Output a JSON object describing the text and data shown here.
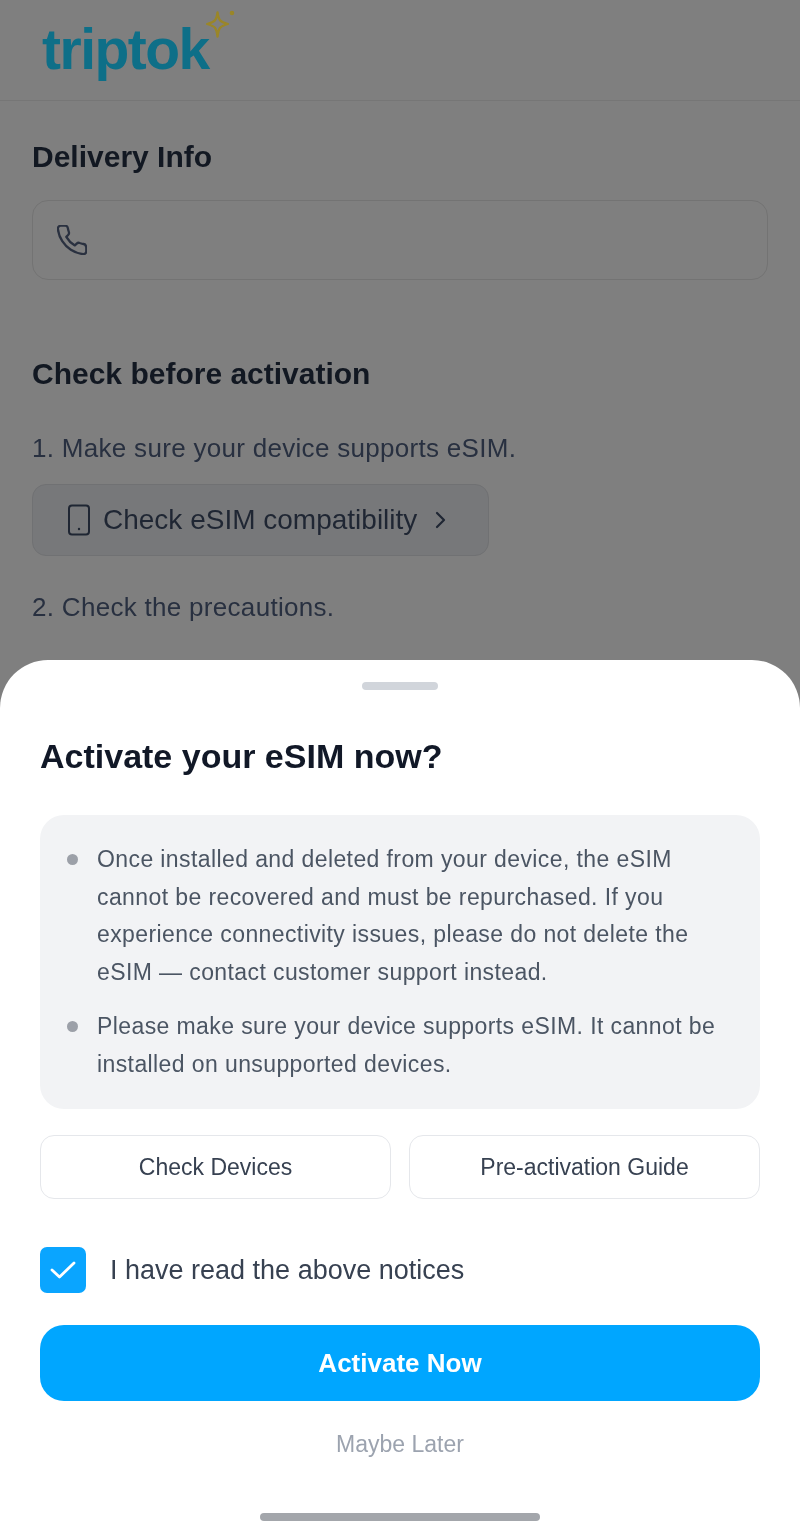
{
  "header": {
    "logo": "triptok"
  },
  "delivery_info": {
    "title": "Delivery Info"
  },
  "check_section": {
    "title": "Check before activation",
    "steps": [
      {
        "text": "1. Make sure your device supports eSIM.",
        "button": "Check eSIM compatibility"
      },
      {
        "text": "2. Check the precautions."
      }
    ]
  },
  "sheet": {
    "title": "Activate your eSIM now?",
    "notices": [
      "Once installed and deleted from your device, the eSIM cannot be recovered and must be repurchased. If you experience connectivity issues, please do not delete the eSIM — contact customer support instead.",
      "Please make sure your device supports eSIM. It cannot be installed on unsupported devices."
    ],
    "buttons": [
      "Check Devices",
      "Pre-activation Guide"
    ],
    "agreement": {
      "label": "I have read the above notices",
      "checked": true
    },
    "primary_button": "Activate Now",
    "secondary_link": "Maybe Later"
  }
}
